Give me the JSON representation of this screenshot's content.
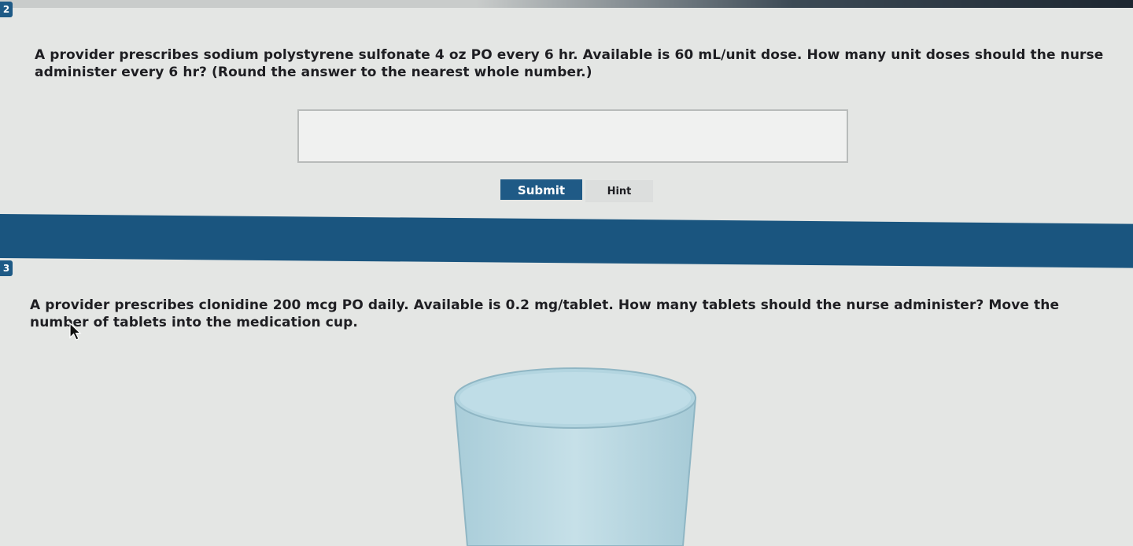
{
  "question1": {
    "number": "2",
    "prompt": "A provider prescribes sodium polystyrene sulfonate 4 oz PO every 6 hr. Available is 60 mL/unit dose. How many unit doses should the nurse administer every 6 hr? (Round the answer to the nearest whole number.)",
    "answer_value": "",
    "submit_label": "Submit",
    "hint_label": "Hint",
    "submit_color": "#1f5a86"
  },
  "question2": {
    "number": "3",
    "prompt": "A provider prescribes clonidine 200 mcg PO daily. Available is 0.2 mg/tablet. How many tablets should the nurse administer? Move the number of tablets into the medication cup.",
    "cup_icon": "medication-cup-icon"
  },
  "colors": {
    "band": "#1a557f",
    "background": "#e4e6e4",
    "cup": "#bcd9e2"
  }
}
